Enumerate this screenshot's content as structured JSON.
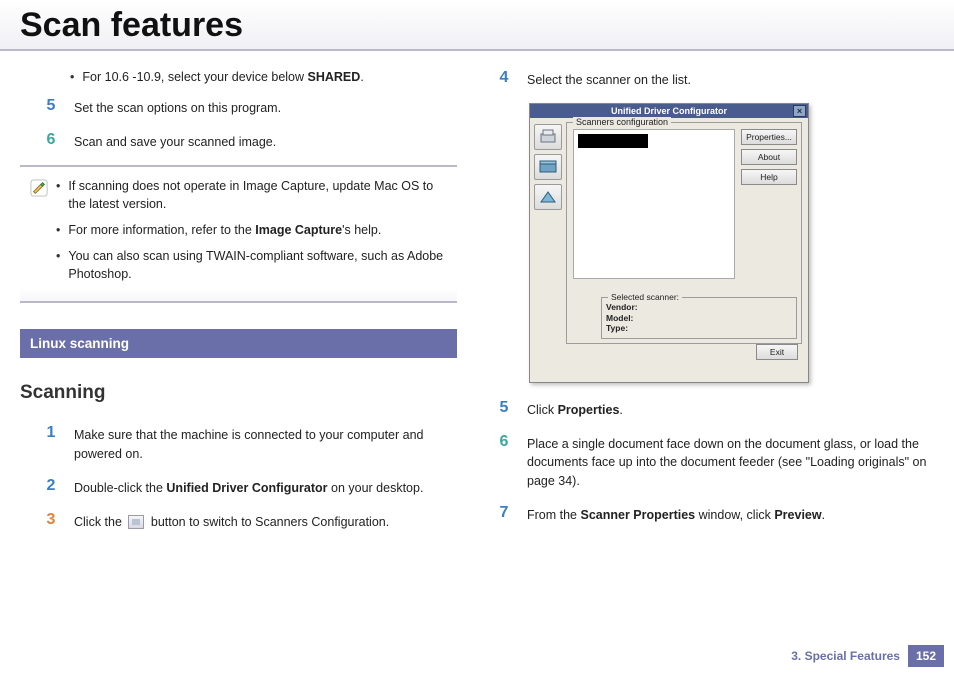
{
  "page_title": "Scan features",
  "left": {
    "mac_bullet_pre": "For 10.6 -10.9, select your device below ",
    "mac_bullet_bold": "SHARED",
    "mac_bullet_post": ".",
    "step5": "Set the scan options on this program.",
    "step6": "Scan and save your scanned image.",
    "note": {
      "n1": "If scanning does not operate in Image Capture, update Mac OS to the latest version.",
      "n2_pre": "For more information, refer to the ",
      "n2_bold": "Image Capture",
      "n2_post": "'s help.",
      "n3": "You can also scan using TWAIN-compliant software, such as Adobe Photoshop."
    },
    "section_bar": "Linux scanning",
    "subheading": "Scanning",
    "s1": "Make sure that the machine is connected to your computer and powered on.",
    "s2_pre": "Double-click the ",
    "s2_bold": "Unified Driver Configurator",
    "s2_post": " on your desktop.",
    "s3_pre": "Click the ",
    "s3_post": " button to switch to Scanners Configuration."
  },
  "right": {
    "s4": "Select the scanner on the list.",
    "win": {
      "title": "Unified Driver Configurator",
      "legend": "Scanners configuration",
      "btn_props": "Properties...",
      "btn_about": "About",
      "btn_help": "Help",
      "sel_legend": "Selected scanner:",
      "sel_vendor": "Vendor:",
      "sel_model": "Model:",
      "sel_type": "Type:",
      "exit": "Exit"
    },
    "s5_pre": "Click ",
    "s5_bold": "Properties",
    "s5_post": ".",
    "s6": "Place a single document face down on the document glass, or load the documents face up into the document feeder (see \"Loading originals\" on page 34).",
    "s7_pre": "From the ",
    "s7_bold1": "Scanner Properties",
    "s7_mid": " window, click ",
    "s7_bold2": "Preview",
    "s7_post": "."
  },
  "footer": {
    "chapter": "3.  Special Features",
    "page": "152"
  },
  "nums": {
    "n1": "1",
    "n2": "2",
    "n3": "3",
    "n4": "4",
    "n5": "5",
    "n6": "6",
    "n7": "7"
  }
}
